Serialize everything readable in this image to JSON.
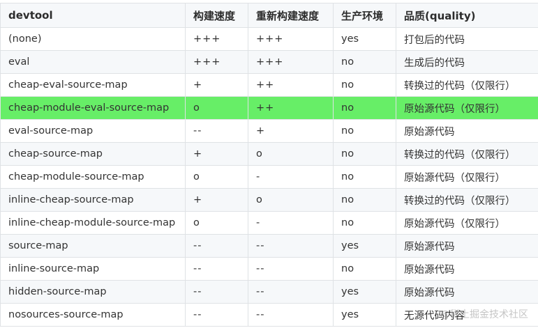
{
  "headers": [
    "devtool",
    "构建速度",
    "重新构建速度",
    "生产环境",
    "品质(quality)"
  ],
  "rows": [
    [
      "(none)",
      "+++",
      "+++",
      "yes",
      "打包后的代码"
    ],
    [
      "eval",
      "+++",
      "+++",
      "no",
      "生成后的代码"
    ],
    [
      "cheap-eval-source-map",
      "+",
      "++",
      "no",
      "转换过的代码（仅限行）"
    ],
    [
      "cheap-module-eval-source-map",
      "o",
      "++",
      "no",
      "原始源代码（仅限行）"
    ],
    [
      "eval-source-map",
      "--",
      "+",
      "no",
      "原始源代码"
    ],
    [
      "cheap-source-map",
      "+",
      "o",
      "no",
      "转换过的代码（仅限行）"
    ],
    [
      "cheap-module-source-map",
      "o",
      "-",
      "no",
      "原始源代码（仅限行）"
    ],
    [
      "inline-cheap-source-map",
      "+",
      "o",
      "no",
      "转换过的代码（仅限行）"
    ],
    [
      "inline-cheap-module-source-map",
      "o",
      "-",
      "no",
      "原始源代码（仅限行）"
    ],
    [
      "source-map",
      "--",
      "--",
      "yes",
      "原始源代码"
    ],
    [
      "inline-source-map",
      "--",
      "--",
      "no",
      "原始源代码"
    ],
    [
      "hidden-source-map",
      "--",
      "--",
      "yes",
      "原始源代码"
    ],
    [
      "nosources-source-map",
      "--",
      "--",
      "yes",
      "无源代码内容"
    ]
  ],
  "highlight_color": "#67ee67",
  "watermark": "@稀土掘金技术社区"
}
